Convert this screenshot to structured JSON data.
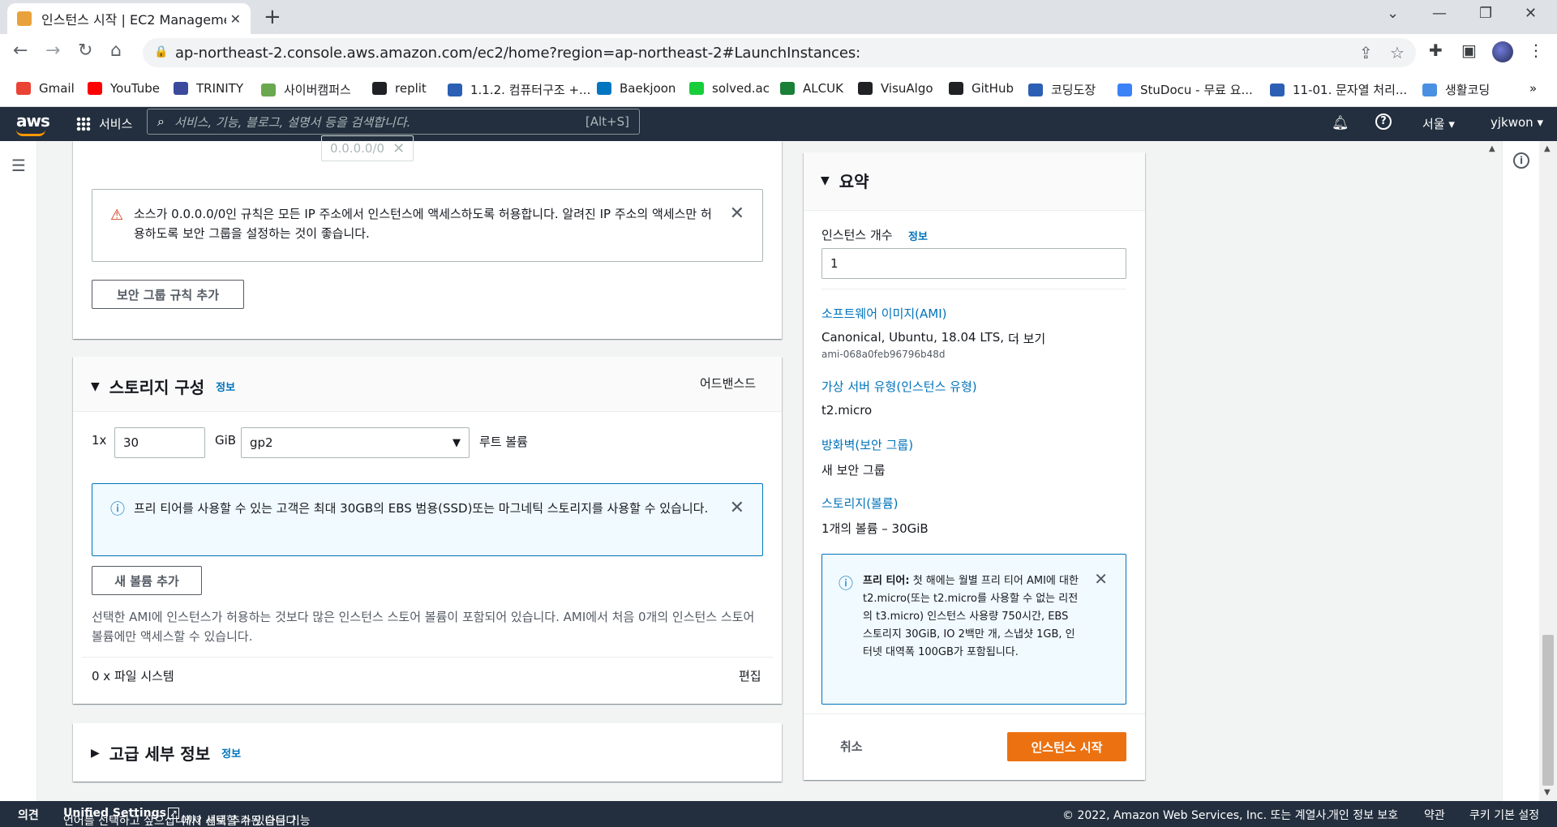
{
  "browser": {
    "tab_title": "인스턴스 시작 | EC2 Management Console",
    "url": "ap-northeast-2.console.aws.amazon.com/ec2/home?region=ap-northeast-2#LaunchInstances:",
    "bookmarks": [
      {
        "label": "Gmail",
        "icon": "gmail-icon",
        "color": "#ea4335"
      },
      {
        "label": "YouTube",
        "icon": "youtube-icon",
        "color": "#ff0000"
      },
      {
        "label": "TRINITY",
        "icon": "trinity-icon",
        "color": "#3b4a9c"
      },
      {
        "label": "사이버캠퍼스",
        "icon": "campus-icon",
        "color": "#6aa84f"
      },
      {
        "label": "replit",
        "icon": "replit-icon",
        "color": "#202124"
      },
      {
        "label": "1.1.2. 컴퓨터구조 +...",
        "icon": "doc-icon",
        "color": "#2b5fb4"
      },
      {
        "label": "Baekjoon",
        "icon": "code-icon",
        "color": "#0076c0"
      },
      {
        "label": "solved.ac",
        "icon": "solved-icon",
        "color": "#17ce3a"
      },
      {
        "label": "ALCUK",
        "icon": "alcuk-icon",
        "color": "#1a7f37"
      },
      {
        "label": "VisuAlgo",
        "icon": "visualgo-icon",
        "color": "#202124"
      },
      {
        "label": "GitHub",
        "icon": "github-icon",
        "color": "#202124"
      },
      {
        "label": "코딩도장",
        "icon": "dojang-icon",
        "color": "#2b5fb4"
      },
      {
        "label": "StuDocu - 무료 요...",
        "icon": "studocu-icon",
        "color": "#3b82f6"
      },
      {
        "label": "11-01. 문자열 처리...",
        "icon": "doc-icon",
        "color": "#2b5fb4"
      },
      {
        "label": "생활코딩",
        "icon": "lifecoding-icon",
        "color": "#4a90e2"
      }
    ],
    "more": "»"
  },
  "aws_header": {
    "logo": "aws",
    "services": "서비스",
    "search_placeholder": "서비스, 기능, 블로그, 설명서 등을 검색합니다.",
    "search_shortcut": "[Alt+S]",
    "region": "서울 ▾",
    "user": "yjkwon ▾"
  },
  "security": {
    "cidr": "0.0.0.0/0",
    "warning": "소스가 0.0.0.0/0인 규칙은 모든 IP 주소에서 인스턴스에 액세스하도록 허용합니다. 알려진 IP 주소의 액세스만 허용하도록 보안 그룹을 설정하는 것이 좋습니다.",
    "add_rule": "보안 그룹 규칙 추가"
  },
  "storage": {
    "title": "스토리지 구성",
    "info": "정보",
    "advanced": "어드밴스드",
    "count_prefix": "1x",
    "size": "30",
    "unit": "GiB",
    "volume_type": "gp2",
    "root_label": "루트 볼륨",
    "free_tier_note": "프리 티어를 사용할 수 있는 고객은 최대 30GB의 EBS 범용(SSD)또는 마그네틱 스토리지를 사용할 수 있습니다.",
    "add_volume": "새 볼륨 추가",
    "store_note": "선택한 AMI에 인스턴스가 허용하는 것보다 많은 인스턴스 스토어 볼륨이 포함되어 있습니다. AMI에서 처음 0개의 인스턴스 스토어 볼륨에만 액세스할 수 있습니다.",
    "filesystems": "0 x 파일 시스템",
    "edit": "편집"
  },
  "advanced_details": {
    "title": "고급 세부 정보",
    "info": "정보"
  },
  "summary": {
    "title": "요약",
    "count_label": "인스턴스 개수",
    "count_info": "정보",
    "count_value": "1",
    "ami_label": "소프트웨어 이미지(AMI)",
    "ami_value": "Canonical, Ubuntu, 18.04 LTS, ...",
    "ami_more": "더 보기",
    "ami_id": "ami-068a0feb96796b48d",
    "type_label": "가상 서버 유형(인스턴스 유형)",
    "type_value": "t2.micro",
    "firewall_label": "방화벽(보안 그룹)",
    "firewall_value": "새 보안 그룹",
    "storage_label": "스토리지(볼륨)",
    "storage_value": "1개의 볼륨 – 30GiB",
    "free_tier_bold": "프리 티어:",
    "free_tier_text": " 첫 해에는 월별 프리 티어 AMI에 대한 t2.micro(또는 t2.micro를 사용할 수 없는 리전의 t3.micro) 인스턴스 사용량 750시간, EBS 스토리지 30GiB, IO 2백만 개, 스냅샷 1GB, 인터넷 대역폭 100GB가 포함됩니다.",
    "cancel": "취소",
    "launch": "인스턴스 시작"
  },
  "footer": {
    "feedback": "의견",
    "lang_prompt": "언어를 선택하고 싶으십니까? 새로 추가된 다음 기능",
    "unified": "Unified Settings",
    "lang_suffix": "에서 선택할 수 있습니다.",
    "copyright": "© 2022, Amazon Web Services, Inc. 또는 계열사.",
    "privacy": "개인 정보 보호",
    "terms": "약관",
    "cookies": "쿠키 기본 설정"
  },
  "colors": {
    "aws_nav": "#232f3e",
    "primary": "#ec7211",
    "link": "#0073bb",
    "warning": "#d13212"
  }
}
